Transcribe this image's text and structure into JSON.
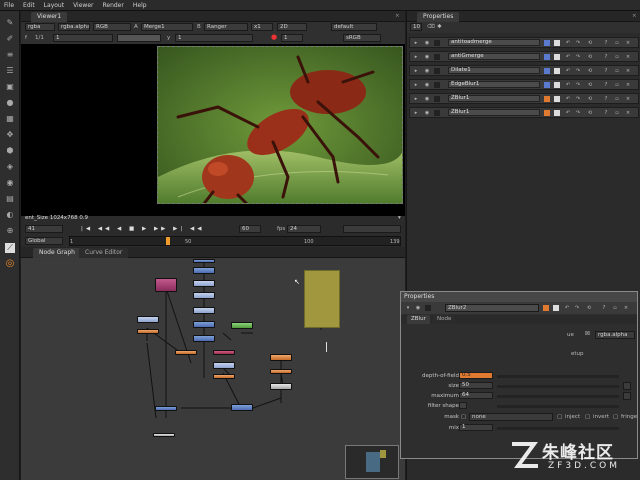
{
  "menu": [
    "File",
    "Edit",
    "Layout",
    "Viewer",
    "Render",
    "Help"
  ],
  "toolbar_icons": [
    "brush-icon",
    "pen-icon",
    "sliders-icon",
    "layers-icon",
    "cube-icon",
    "sphere-icon",
    "channel-icon",
    "transform-icon",
    "3d-icon",
    "eye-icon",
    "image-icon",
    "keyer-icon",
    "merge-icon",
    "clock-icon",
    "nuke-logo-icon"
  ],
  "viewer": {
    "tab": "Viewer1",
    "channels": "rgba",
    "channels2": "rgba.alpha",
    "rgb": "RGB",
    "a_label": "A",
    "input_a": "Merge1",
    "b_label": "B",
    "input_b": "Ranger",
    "zoom": "x1",
    "view": "2D",
    "lut": "default",
    "gain_prefix": "f",
    "gain_value": "1",
    "fstop": "1/1",
    "gamma_prefix": "y",
    "gamma_value": "1",
    "proxy": "1",
    "colorspace": "sRGB",
    "info": "ent_Size 1024x768 0.9",
    "frame": "41",
    "frame_end": "60",
    "fps_label": "fps",
    "fps": "24",
    "range_label": "Global",
    "ticks": [
      "1",
      "50",
      "100",
      "139"
    ]
  },
  "nodegraph": {
    "tabs": [
      "Node Graph",
      "Curve Editor"
    ]
  },
  "properties": {
    "title": "Properties",
    "count": "10",
    "nodes": [
      "antitoadmerge",
      "antiGmerge",
      "Dilate1",
      "EdgeBlur1",
      "ZBlur1",
      "ZBlur1"
    ]
  },
  "float_props": {
    "title": "Properties",
    "node_name": "ZBlur2",
    "tabs": [
      "ZBlur",
      "Node"
    ],
    "channel_label": "ue",
    "channel_value": "rgba.alpha",
    "setup_label": "etup",
    "knobs": [
      {
        "label": "depth-of-field",
        "value": "0.5"
      },
      {
        "label": "size",
        "value": "50"
      },
      {
        "label": "maximum",
        "value": "64"
      },
      {
        "label": "filter shape",
        "value": ""
      },
      {
        "label": "mask",
        "value": "none"
      },
      {
        "label": "mix",
        "value": "1"
      }
    ],
    "mask_options": [
      "inject",
      "invert",
      "fringe"
    ],
    "colors": {
      "accent": "#8aa0c8",
      "border": "#8a8a8a"
    }
  },
  "watermark": {
    "brand": "朱峰社区",
    "site": "ZF3D.COM"
  }
}
